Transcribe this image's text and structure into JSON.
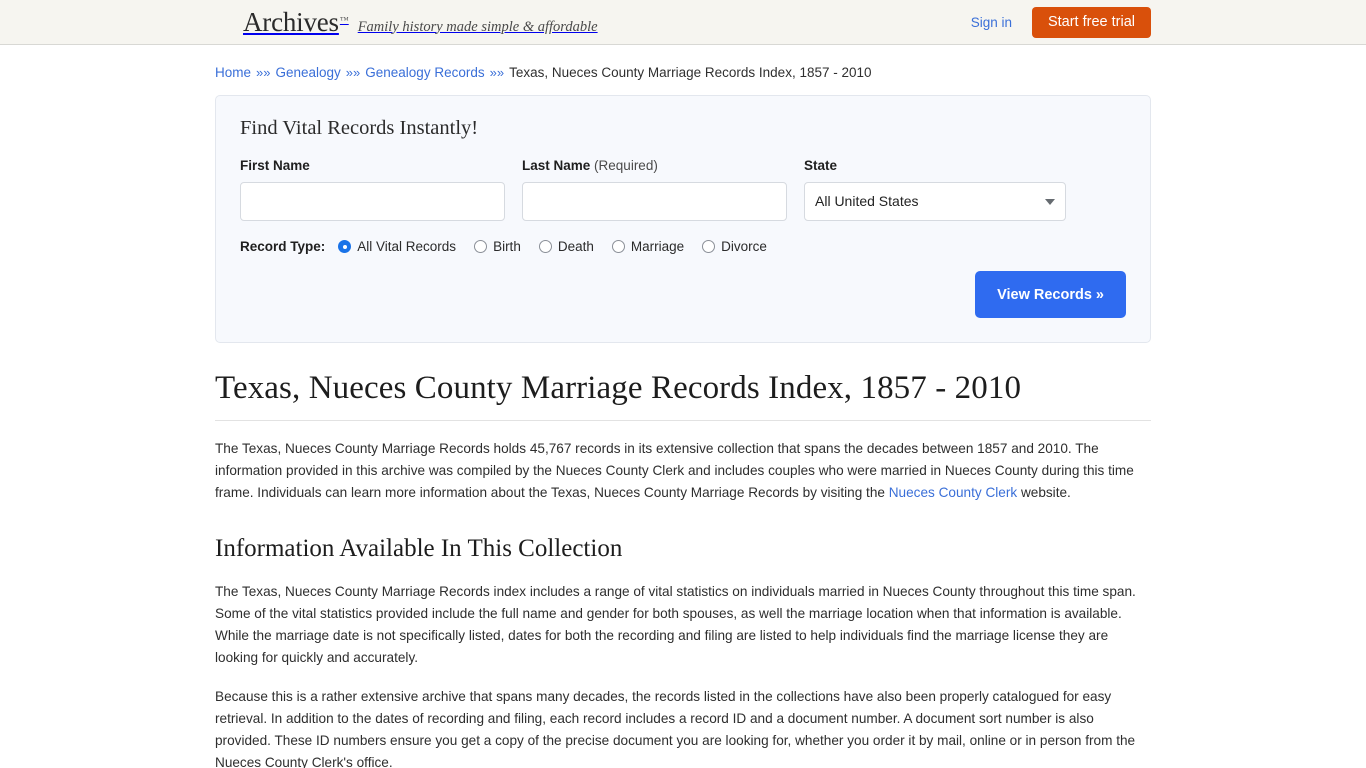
{
  "header": {
    "brand": "Archives",
    "trademark": "™",
    "tagline": "Family history made simple & affordable",
    "sign_in": "Sign in",
    "start_trial": "Start free trial",
    "accent_orange": "#d9500b",
    "link_blue": "#3a6fd8"
  },
  "breadcrumb": {
    "items": [
      {
        "label": "Home",
        "link": true
      },
      {
        "label": "Genealogy",
        "link": true
      },
      {
        "label": "Genealogy Records",
        "link": true
      },
      {
        "label": "Texas, Nueces County Marriage Records Index, 1857 - 2010",
        "link": false
      }
    ],
    "separator": "»»"
  },
  "search_panel": {
    "title": "Find Vital Records Instantly!",
    "first_name": {
      "label": "First Name",
      "value": "",
      "placeholder": ""
    },
    "last_name": {
      "label": "Last Name",
      "required_note": "(Required)",
      "value": "",
      "placeholder": ""
    },
    "state": {
      "label": "State",
      "selected": "All United States",
      "caret_icon": "chevron-down-icon"
    },
    "record_type": {
      "label": "Record Type:",
      "options": [
        {
          "label": "All Vital Records",
          "checked": true
        },
        {
          "label": "Birth",
          "checked": false
        },
        {
          "label": "Death",
          "checked": false
        },
        {
          "label": "Marriage",
          "checked": false
        },
        {
          "label": "Divorce",
          "checked": false
        }
      ]
    },
    "submit_label": "View Records »",
    "submit_color": "#2f6bf0",
    "panel_bg": "#f7f9fd"
  },
  "article": {
    "title": "Texas, Nueces County Marriage Records Index, 1857 - 2010",
    "intro_part1": "The Texas, Nueces County Marriage Records holds 45,767 records in its extensive collection that spans the decades between 1857 and 2010. The information provided in this archive was compiled by the Nueces County Clerk and includes couples who were married in Nueces County during this time frame. Individuals can learn more information about the Texas, Nueces County Marriage Records by visiting the ",
    "intro_link": "Nueces County Clerk",
    "intro_part2": " website.",
    "section_heading": "Information Available In This Collection",
    "paragraph_2": "The Texas, Nueces County Marriage Records index includes a range of vital statistics on individuals married in Nueces County throughout this time span. Some of the vital statistics provided include the full name and gender for both spouses, as well the marriage location when that information is available. While the marriage date is not specifically listed, dates for both the recording and filing are listed to help individuals find the marriage license they are looking for quickly and accurately.",
    "paragraph_3": "Because this is a rather extensive archive that spans many decades, the records listed in the collections have also been properly catalogued for easy retrieval. In addition to the dates of recording and filing, each record includes a record ID and a document number. A document sort number is also provided. These ID numbers ensure you get a copy of the precise document you are looking for, whether you order it by mail, online or in person from the Nueces County Clerk's office.",
    "record_count": "45,767",
    "year_start": "1857",
    "year_end": "2010"
  }
}
